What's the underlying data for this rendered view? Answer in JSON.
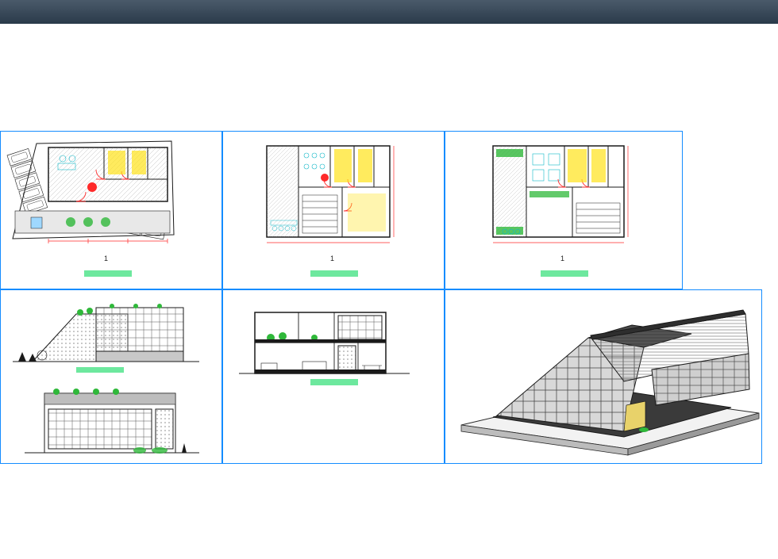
{
  "titlebar": {
    "app": ""
  },
  "sheets": [
    {
      "name": "ground-floor-plan",
      "marker": "1"
    },
    {
      "name": "first-floor-plan",
      "marker": "1"
    },
    {
      "name": "second-floor-plan",
      "marker": "1"
    },
    {
      "name": "elevations",
      "marker": ""
    },
    {
      "name": "section",
      "marker": ""
    },
    {
      "name": "perspective-3d",
      "marker": ""
    }
  ],
  "colors": {
    "frame": "#148cff",
    "label": "#6de89e",
    "wall": "#1a1a1a",
    "hatch": "#7c7c7c",
    "door": "#ff2a2a",
    "furniture": "#10b8c8",
    "highlight": "#ffe31a",
    "green": "#2fb83a"
  }
}
